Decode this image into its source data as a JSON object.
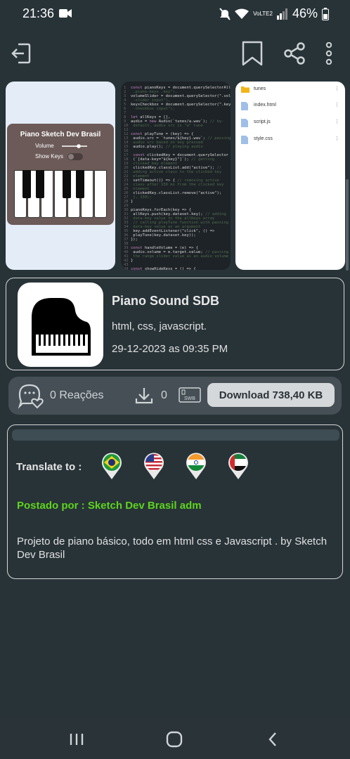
{
  "status_bar": {
    "time": "21:36",
    "network": "VoLTE2",
    "battery": "46%"
  },
  "toolbar": {
    "exit_icon": "exit-icon",
    "bookmark_icon": "bookmark-icon",
    "share_icon": "share-icon",
    "more_icon": "more-vert-icon"
  },
  "gallery": {
    "preview1": {
      "title": "Piano Sketch Dev Brasil",
      "volume_label": "Volume",
      "show_keys_label": "Show Keys"
    },
    "preview2": {
      "lines": [
        "const pianoKeys = document.querySelectorAll(\"",
        "  .piano-keys .key\"),",
        "volumeSlider = document.querySelector(\".volume",
        "  -slider input\"),",
        "keysCheckbox = document.querySelector(\".keys",
        "  -checkbox input\");",
        "",
        "let allKeys = [],",
        "audio = new Audio(`tunes/a.wav`); // by-",
        "  default, audio src is \"a\" tune",
        "",
        "const playTune = (key) => {",
        "  audio.src = `tunes/${key}.wav`; // passing",
        "    audio src based on key pressed",
        "  audio.play(); // playing audio",
        "",
        "  const clickedKey = document.querySelector",
        "    (`[data-key=\"${key}\"]`); // getting",
        "    clicked key element",
        "  clickedKey.classList.add(\"active\"); //",
        "    adding active class to the clicked key",
        "    element",
        "  setTimeout(() => { // removing active",
        "    class after 150 ms from the clicked key",
        "    element",
        "    clickedKey.classList.remove(\"active\");",
        "  }, 150);",
        "}",
        "",
        "pianoKeys.forEach(key => {",
        "  allKeys.push(key.dataset.key); // adding",
        "    data-key value to the allKeys array",
        "  // calling playTune function with passing",
        "    data-key value as an argument",
        "  key.addEventListener(\"click\", () =>",
        "    playTune(key.dataset.key));",
        "});",
        "",
        "const handleVolume = (e) => {",
        "  audio.volume = e.target.value; // passing",
        "    the range slider value as an audio volume",
        "}",
        "",
        "const showHideKeys = () => {"
      ]
    },
    "preview3": {
      "files": [
        {
          "name": "tunes",
          "icon": "folder-icon"
        },
        {
          "name": "index.html",
          "icon": "file-icon"
        },
        {
          "name": "script.js",
          "icon": "file-icon"
        },
        {
          "name": "style.css",
          "icon": "file-icon"
        }
      ]
    }
  },
  "project": {
    "name": "Piano Sound SDB",
    "languages": "html, css, javascript.",
    "date": "29-12-2023 as 09:35 PM"
  },
  "actions": {
    "reactions": "0 Reações",
    "downloads": "0",
    "download_button": "Download 738,40 KB"
  },
  "details": {
    "translate_label": "Translate to :",
    "flags": [
      {
        "name": "brazil-flag-icon"
      },
      {
        "name": "usa-flag-icon"
      },
      {
        "name": "india-flag-icon"
      },
      {
        "name": "uae-flag-icon"
      }
    ],
    "posted_by": "Postado por : Sketch Dev Brasil adm",
    "description": "Projeto de piano básico,  todo em html css e Javascript . by Sketch Dev Brasil"
  },
  "colors": {
    "background": "#283338",
    "posted_green": "#5ed41e",
    "download_button_bg": "#d5d8da"
  }
}
